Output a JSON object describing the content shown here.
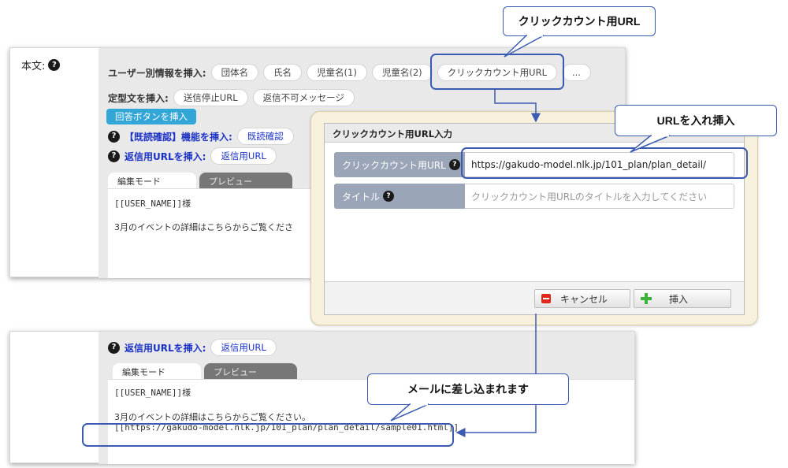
{
  "callouts": {
    "click_url": "クリックカウント用URL",
    "enter_url": "URLを入れ挿入",
    "inserted": "メールに差し込まれます"
  },
  "editor_top": {
    "body_label": "本文:",
    "help_icon": "?",
    "user_info_label": "ユーザー別情報を挿入:",
    "user_info_pills": [
      "団体名",
      "氏名",
      "児童名(1)",
      "児童名(2)",
      "クリックカウント用URL",
      "..."
    ],
    "template_label": "定型文を挿入:",
    "template_pills": [
      "送信停止URL",
      "返信不可メッセージ"
    ],
    "reply_button": "回答ボタンを挿入",
    "read_confirm_label": "【既読確認】機能を挿入:",
    "read_confirm_pill": "既読確認",
    "reply_url_label": "返信用URLを挿入:",
    "reply_url_pill": "返信用URL",
    "tab_edit": "編集モード",
    "tab_preview": "プレビュー",
    "line1": "[[USER_NAME]]様",
    "line2": "3月のイベントの詳細はこちらからご覧くださ"
  },
  "dialog": {
    "title": "クリックカウント用URL入力",
    "url_label": "クリックカウント用URL",
    "url_value": "https://gakudo-model.nlk.jp/101_plan/plan_detail/",
    "title_label": "タイトル",
    "title_placeholder": "クリックカウント用URLのタイトルを入力してください",
    "cancel_label": "キャンセル",
    "insert_label": "挿入"
  },
  "editor_bottom": {
    "reply_url_label": "返信用URLを挿入:",
    "reply_url_pill": "返信用URL",
    "tab_edit": "編集モード",
    "tab_preview": "プレビュー",
    "line1": "[[USER_NAME]]様",
    "line2": "3月のイベントの詳細はこちらからご覧ください。",
    "line3": "[[https://gakudo-model.nlk.jp/101_plan/plan_detail/sample01.html]]"
  },
  "colors": {
    "accent_blue": "#3b5bb2",
    "link_blue": "#1c33c8",
    "reply_button_bg": "#33a6d8",
    "dialog_bg": "#f7f0dc",
    "form_label_bg": "#9aa5b8"
  }
}
